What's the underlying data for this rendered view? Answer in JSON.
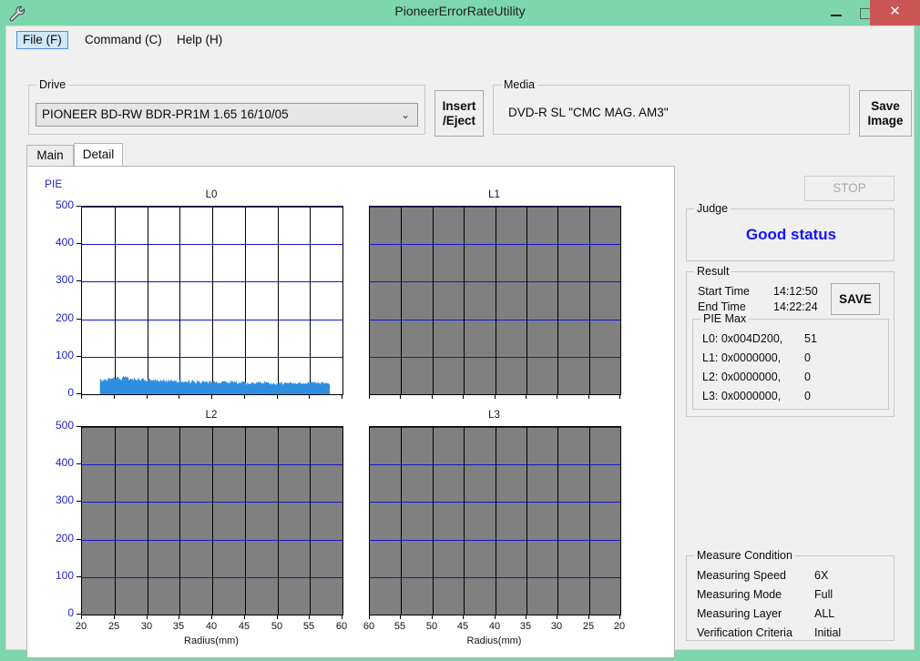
{
  "window": {
    "title": "PioneerErrorRateUtility",
    "icon": "wrench-icon",
    "minimize": "─",
    "maximize": "□",
    "close": "✕",
    "accent_titlebar": "#7ed6ae",
    "close_color": "#cc5555"
  },
  "menu": {
    "file": "File (F)",
    "command": "Command (C)",
    "help": "Help (H)"
  },
  "drive": {
    "legend": "Drive",
    "selected": "PIONEER BD-RW BDR-PR1M  1.65 16/10/05",
    "caret": "⌄"
  },
  "media": {
    "legend": "Media",
    "value": "DVD-R SL \"CMC MAG. AM3\""
  },
  "buttons": {
    "insert_eject_line1": "Insert",
    "insert_eject_line2": "/Eject",
    "save_image_line1": "Save",
    "save_image_line2": "Image",
    "stop": "STOP",
    "save": "SAVE"
  },
  "tabs": {
    "main": "Main",
    "detail": "Detail",
    "active": "Detail"
  },
  "judge": {
    "legend": "Judge",
    "status": "Good status",
    "color": "#1414ff"
  },
  "result": {
    "legend": "Result",
    "start_label": "Start Time",
    "start_value": "14:12:50",
    "end_label": "End Time",
    "end_value": "14:22:24",
    "pie_max_legend": "PIE Max",
    "pie_max": [
      {
        "label": "L0: 0x004D200,",
        "value": "51"
      },
      {
        "label": "L1: 0x0000000,",
        "value": "0"
      },
      {
        "label": "L2: 0x0000000,",
        "value": "0"
      },
      {
        "label": "L3: 0x0000000,",
        "value": "0"
      }
    ]
  },
  "measure_condition": {
    "legend": "Measure Condition",
    "rows": [
      {
        "label": "Measuring Speed",
        "value": "6X"
      },
      {
        "label": "Measuring Mode",
        "value": "Full"
      },
      {
        "label": "Measuring Layer",
        "value": "ALL"
      },
      {
        "label": "Verification Criteria",
        "value": "Initial"
      }
    ]
  },
  "chart_data": [
    {
      "type": "area",
      "title": "L0",
      "ylabel": "PIE",
      "xlabel": "Radius(mm)",
      "ylim": [
        0,
        500
      ],
      "yticks": [
        0,
        100,
        200,
        300,
        400,
        500
      ],
      "xlim": [
        20,
        60
      ],
      "xticks": [
        20,
        25,
        30,
        35,
        40,
        45,
        50,
        55,
        60
      ],
      "grid": true,
      "has_data": true,
      "series_color": "#2e8ee0",
      "x": [
        22.8,
        23.5,
        24.2,
        25.0,
        25.8,
        26.5,
        27.3,
        28.0,
        28.8,
        29.5,
        30.3,
        31.0,
        31.8,
        32.5,
        33.3,
        34.0,
        34.8,
        35.5,
        36.3,
        37.0,
        37.8,
        38.5,
        39.3,
        40.0,
        40.8,
        41.5,
        42.3,
        43.0,
        43.8,
        44.5,
        45.3,
        46.0,
        46.8,
        47.5,
        48.3,
        49.0,
        49.8,
        50.5,
        51.3,
        52.0,
        52.8,
        53.5,
        54.3,
        55.0,
        55.8,
        56.5,
        57.3,
        58.0
      ],
      "values": [
        40,
        42,
        44,
        47,
        46,
        51,
        44,
        46,
        43,
        42,
        41,
        40,
        41,
        39,
        40,
        38,
        39,
        38,
        37,
        38,
        37,
        36,
        37,
        36,
        37,
        36,
        35,
        36,
        35,
        36,
        34,
        35,
        34,
        33,
        34,
        33,
        32,
        33,
        32,
        33,
        32,
        33,
        34,
        33,
        34,
        33,
        32,
        30
      ],
      "pie_max": 51
    },
    {
      "type": "area",
      "title": "L1",
      "ylabel": "PIE",
      "xlabel": "Radius(mm)",
      "ylim": [
        0,
        500
      ],
      "yticks": [
        0,
        100,
        200,
        300,
        400,
        500
      ],
      "xlim": [
        60,
        20
      ],
      "xticks": [
        60,
        55,
        50,
        45,
        40,
        35,
        30,
        25,
        20
      ],
      "grid": true,
      "has_data": false,
      "disabled_fill": "#808080",
      "x": [],
      "values": [],
      "pie_max": 0
    },
    {
      "type": "area",
      "title": "L2",
      "ylabel": "PIE",
      "xlabel": "Radius(mm)",
      "ylim": [
        0,
        500
      ],
      "yticks": [
        0,
        100,
        200,
        300,
        400,
        500
      ],
      "xlim": [
        20,
        60
      ],
      "xticks": [
        20,
        25,
        30,
        35,
        40,
        45,
        50,
        55,
        60
      ],
      "grid": true,
      "has_data": false,
      "disabled_fill": "#808080",
      "x": [],
      "values": [],
      "pie_max": 0
    },
    {
      "type": "area",
      "title": "L3",
      "ylabel": "PIE",
      "xlabel": "Radius(mm)",
      "ylim": [
        0,
        500
      ],
      "yticks": [
        0,
        100,
        200,
        300,
        400,
        500
      ],
      "xlim": [
        60,
        20
      ],
      "xticks": [
        60,
        55,
        50,
        45,
        40,
        35,
        30,
        25,
        20
      ],
      "grid": true,
      "has_data": false,
      "disabled_fill": "#808080",
      "x": [],
      "values": [],
      "pie_max": 0
    }
  ]
}
